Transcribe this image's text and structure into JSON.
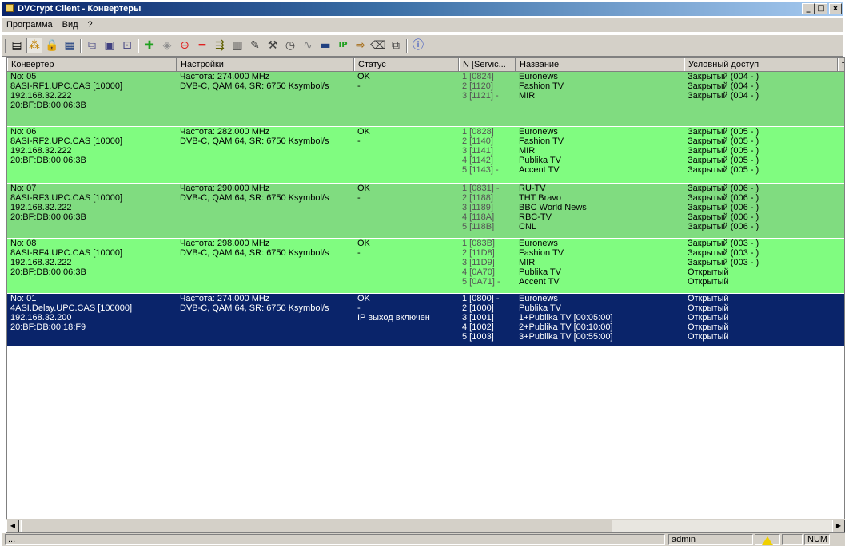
{
  "window": {
    "title": "DVCrypt Client - Конвертеры",
    "min": "_",
    "max": "□",
    "close": "x"
  },
  "menu": [
    "Программа",
    "Вид",
    "?"
  ],
  "columns": [
    "Конвертер",
    "Настройки",
    "Статус",
    "N [Servic...",
    "Название",
    "Условный доступ",
    "f"
  ],
  "groups": [
    {
      "conv": [
        "No: 05",
        "8ASI-RF1.UPC.CAS [10000]",
        "192.168.32.222",
        "20:BF:DB:00:06:3B"
      ],
      "settings": [
        "Частота: 274.000 MHz",
        "DVB-C, QAM 64, SR: 6750 Ksymbol/s"
      ],
      "status": [
        "OK",
        "-"
      ],
      "services": [
        {
          "n": "1 [0824]",
          "name": "Euronews",
          "ca": "Закрытый (004 - )"
        },
        {
          "n": "2 [1120]",
          "name": "Fashion TV",
          "ca": "Закрытый (004 - )"
        },
        {
          "n": "3 [1121] -",
          "name": "MIR",
          "ca": "Закрытый (004 - )"
        }
      ]
    },
    {
      "conv": [
        "No: 06",
        "8ASI-RF2.UPC.CAS [10000]",
        "192.168.32.222",
        "20:BF:DB:00:06:3B"
      ],
      "settings": [
        "Частота: 282.000 MHz",
        "DVB-C, QAM 64, SR: 6750 Ksymbol/s"
      ],
      "status": [
        "OK",
        "-"
      ],
      "services": [
        {
          "n": "1 [0828]",
          "name": "Euronews",
          "ca": "Закрытый (005 - )"
        },
        {
          "n": "2 [1140]",
          "name": "Fashion TV",
          "ca": "Закрытый (005 - )"
        },
        {
          "n": "3 [1141]",
          "name": "MIR",
          "ca": "Закрытый (005 - )"
        },
        {
          "n": "4 [1142]",
          "name": "Publika TV",
          "ca": "Закрытый (005 - )"
        },
        {
          "n": "5 [1143] -",
          "name": "Accent TV",
          "ca": "Закрытый (005 - )"
        }
      ]
    },
    {
      "conv": [
        "No: 07",
        "8ASI-RF3.UPC.CAS [10000]",
        "192.168.32.222",
        "20:BF:DB:00:06:3B"
      ],
      "settings": [
        "Частота: 290.000 MHz",
        "DVB-C, QAM 64, SR: 6750 Ksymbol/s"
      ],
      "status": [
        "OK",
        "-"
      ],
      "services": [
        {
          "n": "1 [0831] -",
          "name": "RU-TV",
          "ca": "Закрытый (006 - )"
        },
        {
          "n": "2 [1188]",
          "name": "THT Bravo",
          "ca": "Закрытый (006 - )"
        },
        {
          "n": "3 [1189]",
          "name": "BBC World News",
          "ca": "Закрытый (006 - )"
        },
        {
          "n": "4 [118A]",
          "name": "RBC-TV",
          "ca": "Закрытый (006 - )"
        },
        {
          "n": "5 [118B]",
          "name": "CNL",
          "ca": "Закрытый (006 - )"
        }
      ]
    },
    {
      "conv": [
        "No: 08",
        "8ASI-RF4.UPC.CAS [10000]",
        "192.168.32.222",
        "20:BF:DB:00:06:3B"
      ],
      "settings": [
        "Частота: 298.000 MHz",
        "DVB-C, QAM 64, SR: 6750 Ksymbol/s"
      ],
      "status": [
        "OK",
        "-"
      ],
      "services": [
        {
          "n": "1 [083B]",
          "name": "Euronews",
          "ca": "Закрытый (003 - )"
        },
        {
          "n": "2 [11D8]",
          "name": "Fashion TV",
          "ca": "Закрытый (003 - )"
        },
        {
          "n": "3 [11D9]",
          "name": "MIR",
          "ca": "Закрытый (003 - )"
        },
        {
          "n": "4 [0A70]",
          "name": "Publika TV",
          "ca": "Открытый"
        },
        {
          "n": "5 [0A71] -",
          "name": "Accent TV",
          "ca": "Открытый"
        }
      ]
    },
    {
      "conv": [
        "No: 01",
        "4ASI.Delay.UPC.CAS [100000]",
        "192.168.32.200",
        "20:BF:DB:00:18:F9"
      ],
      "settings": [
        "Частота: 274.000 MHz",
        "DVB-C, QAM 64, SR: 6750 Ksymbol/s"
      ],
      "status": [
        "OK",
        "-",
        "IP выход включен"
      ],
      "services": [
        {
          "n": "1 [0800] -",
          "name": "Euronews",
          "ca": "Открытый"
        },
        {
          "n": "2 [1000]",
          "name": "Publika TV",
          "ca": "Открытый"
        },
        {
          "n": "3 [1001]",
          "name": "1+Publika TV [00:05:00]",
          "ca": "Открытый"
        },
        {
          "n": "4 [1002]",
          "name": "2+Publika TV [00:10:00]",
          "ca": "Открытый"
        },
        {
          "n": "5 [1003]",
          "name": "3+Publika TV [00:55:00]",
          "ca": "Открытый"
        }
      ]
    }
  ],
  "status_bar": {
    "left": "...",
    "user": "admin",
    "num": "NUM"
  },
  "colors": {
    "row_a": "#80dc80",
    "row_b": "#80fc80",
    "row_selected": "#0a246a"
  }
}
